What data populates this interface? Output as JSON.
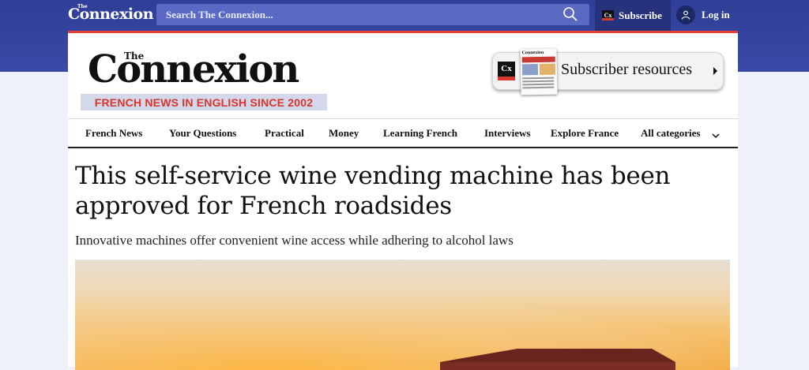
{
  "topbar": {
    "brand": "Connexion",
    "brand_the": "The",
    "search_placeholder": "Search The Connexion...",
    "subscribe_label": "Subscribe",
    "subscribe_badge": "Cx",
    "login_label": "Log in"
  },
  "masthead": {
    "logo_the": "The",
    "logo": "Connexion",
    "tagline": "FRENCH NEWS IN ENGLISH SINCE 2002",
    "resources_label": "Subscriber resources",
    "resources_badge": "Cx",
    "paper_title": "Connexion"
  },
  "nav": {
    "items": [
      "French News",
      "Your Questions",
      "Practical",
      "Money",
      "Learning French",
      "Interviews",
      "Explore France",
      "All categories"
    ]
  },
  "article": {
    "headline": "This self-service wine vending machine has been approved for French roadsides",
    "standfirst": "Innovative machines offer convenient wine access while adhering to alcohol laws"
  },
  "colors": {
    "topbar_blue": "#2f3f97",
    "search_bg": "#5a69c4",
    "subscribe_bg": "#26337c",
    "accent_red": "#e43f35",
    "tagline_bg": "#d3d9ea"
  },
  "icons": {
    "search": "search-icon",
    "user": "user-icon",
    "chevron": "chevron-down-icon"
  }
}
